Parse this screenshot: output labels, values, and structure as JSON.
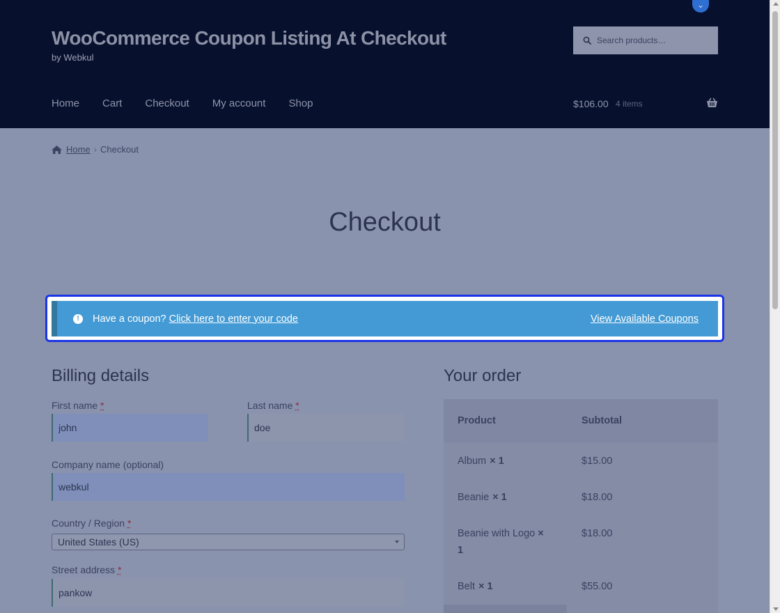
{
  "header": {
    "site_title": "WooCommerce Coupon Listing At Checkout",
    "tagline": "by Webkul",
    "search_placeholder": "Search products…",
    "nav": [
      "Home",
      "Cart",
      "Checkout",
      "My account",
      "Shop"
    ],
    "cart_total": "$106.00",
    "cart_count": "4 items"
  },
  "breadcrumb": {
    "home": "Home",
    "sep": "›",
    "current": "Checkout"
  },
  "page_title": "Checkout",
  "notice": {
    "icon": "!",
    "text": "Have a coupon?",
    "link": "Click here to enter your code",
    "view_coupons": "View Available Coupons"
  },
  "billing": {
    "heading": "Billing details",
    "first_name_label": "First name",
    "last_name_label": "Last name",
    "company_label": "Company name (optional)",
    "country_label": "Country / Region",
    "street_label": "Street address",
    "required_mark": "*",
    "first_name": "john",
    "last_name": "doe",
    "company": "webkul",
    "country": "United States (US)",
    "street": "pankow"
  },
  "order": {
    "heading": "Your order",
    "col_product": "Product",
    "col_subtotal": "Subtotal",
    "items": [
      {
        "name": "Album",
        "qty": "× 1",
        "price": "$15.00"
      },
      {
        "name": "Beanie",
        "qty": "× 1",
        "price": "$18.00"
      },
      {
        "name": "Beanie with Logo",
        "qty": "× 1",
        "price": "$18.00"
      },
      {
        "name": "Belt",
        "qty": "× 1",
        "price": "$55.00"
      }
    ]
  },
  "colors": {
    "header_bg": "#07102d",
    "notice_bg": "#439ad4",
    "highlight_border": "#1a34e8"
  }
}
